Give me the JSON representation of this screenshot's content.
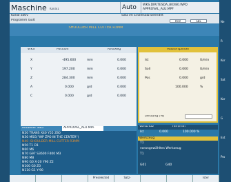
{
  "header": {
    "mode": "Maschine",
    "channel": "Kanal1",
    "op_mode": "Auto",
    "program_path_1": "WKS.DIR\\TESDA_80X80.WPD",
    "program_path_2": "APPROVAL_ALU.MPF",
    "channel_status": "Kanal aktiv",
    "reset_status": "Satz im Einzelsatz beendet",
    "prog_status": "Programm läuft",
    "rov": "ROV",
    "sbl": "SBL",
    "title_line": "SHOULDER MILL CUTTER R3MM"
  },
  "axes": {
    "headers": [
      "WKS",
      "Position",
      "Restweg"
    ],
    "rows": [
      {
        "axis": "X",
        "position": "-495.600",
        "unit": "mm",
        "rest": "0.000"
      },
      {
        "axis": "Y",
        "position": "197.200",
        "unit": "mm",
        "rest": "0.000"
      },
      {
        "axis": "Z",
        "position": "284.300",
        "unit": "mm",
        "rest": "0.000"
      },
      {
        "axis": "A",
        "position": "0.000",
        "unit": "grd",
        "rest": "0.000"
      },
      {
        "axis": "C",
        "position": "0.000",
        "unit": "grd",
        "rest": "0.000"
      }
    ]
  },
  "spindle": {
    "title": "Masterspindel",
    "rows": [
      {
        "label": "Ist",
        "value": "0.000",
        "unit": "U/min"
      },
      {
        "label": "Soll",
        "value": "0.000",
        "unit": "U/min"
      },
      {
        "label": "Pos",
        "value": "0.000",
        "unit": "grd"
      },
      {
        "label": "",
        "value": "100.000",
        "unit": "%"
      }
    ],
    "power_label": "Leistung [%]"
  },
  "program": {
    "header": "Aktueller Satz",
    "name": "APPROVAL_ALU.MPF",
    "lines": [
      "N20 TRANS X40 Y55 Z80",
      "N30 MSG(\"WP ZPO IN THE CENTER\")",
      "N40 ;SHOULDER MILL CUTTER R3MM",
      "N50 T1 D1",
      "N60 M6",
      "N70 G97 S3600 F400 M3",
      "N80 M8",
      "N90 G0 X-20 Y90 Z2",
      "N100 G0 Z0",
      "N110 G1 Y-90"
    ]
  },
  "feed": {
    "header_left": "Vorschub",
    "header_right": "mm/min",
    "rows": [
      {
        "label": "Ist",
        "value": "0.000",
        "unit": "100.000 %"
      },
      {
        "label": "Soll",
        "value": "0.000",
        "unit": ""
      }
    ]
  },
  "tool": {
    "title": "Werkzeug",
    "lines": [
      "T1",
      "vorangewähltes Werkzeug",
      "T1",
      "G01",
      "G40"
    ]
  },
  "softkeys": [
    "",
    "",
    "",
    "Preselected",
    "Satz-",
    "",
    "",
    "Ister"
  ],
  "right_softkeys": [
    "Ne",
    "R",
    "Kor",
    "Sat",
    "Kor",
    "G",
    "Ext",
    "Pro"
  ],
  "colors": {
    "accent": "#e1c13b",
    "bg": "#2a78a8",
    "panel_dark": "#1d4f73"
  }
}
